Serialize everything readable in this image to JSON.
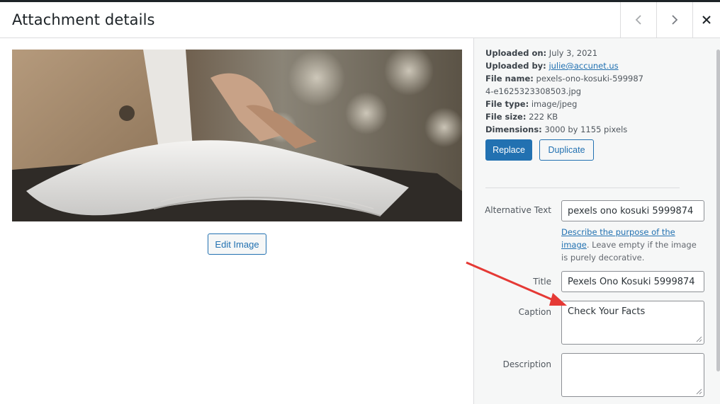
{
  "modal": {
    "title": "Attachment details",
    "prev_icon": "chevron-left-icon",
    "next_icon": "chevron-right-icon",
    "close_icon": "close-icon"
  },
  "preview": {
    "image_alt": "pexels ono kosuki 5999874",
    "edit_label": "Edit Image"
  },
  "details": {
    "uploaded_on_label": "Uploaded on:",
    "uploaded_on": "July 3, 2021",
    "uploaded_by_label": "Uploaded by:",
    "uploaded_by": "julie@accunet.us",
    "file_name_label": "File name:",
    "file_name": "pexels-ono-kosuki-5999874-e1625323308503.jpg",
    "file_type_label": "File type:",
    "file_type": "image/jpeg",
    "file_size_label": "File size:",
    "file_size": "222 KB",
    "dimensions_label": "Dimensions:",
    "dimensions": "3000 by 1155 pixels"
  },
  "actions": {
    "replace_label": "Replace",
    "duplicate_label": "Duplicate"
  },
  "fields": {
    "alt_label": "Alternative Text",
    "alt_value": "pexels ono kosuki 5999874",
    "alt_help_link": "Describe the purpose of the image",
    "alt_help_text": ". Leave empty if the image is purely decorative.",
    "title_label": "Title",
    "title_value": "Pexels Ono Kosuki 5999874",
    "caption_label": "Caption",
    "caption_value": "Check Your Facts",
    "description_label": "Description",
    "description_value": ""
  },
  "annotation": {
    "arrow_color": "#e53935"
  },
  "colors": {
    "primary": "#2271b1",
    "sidebar_bg": "#f6f7f7"
  }
}
